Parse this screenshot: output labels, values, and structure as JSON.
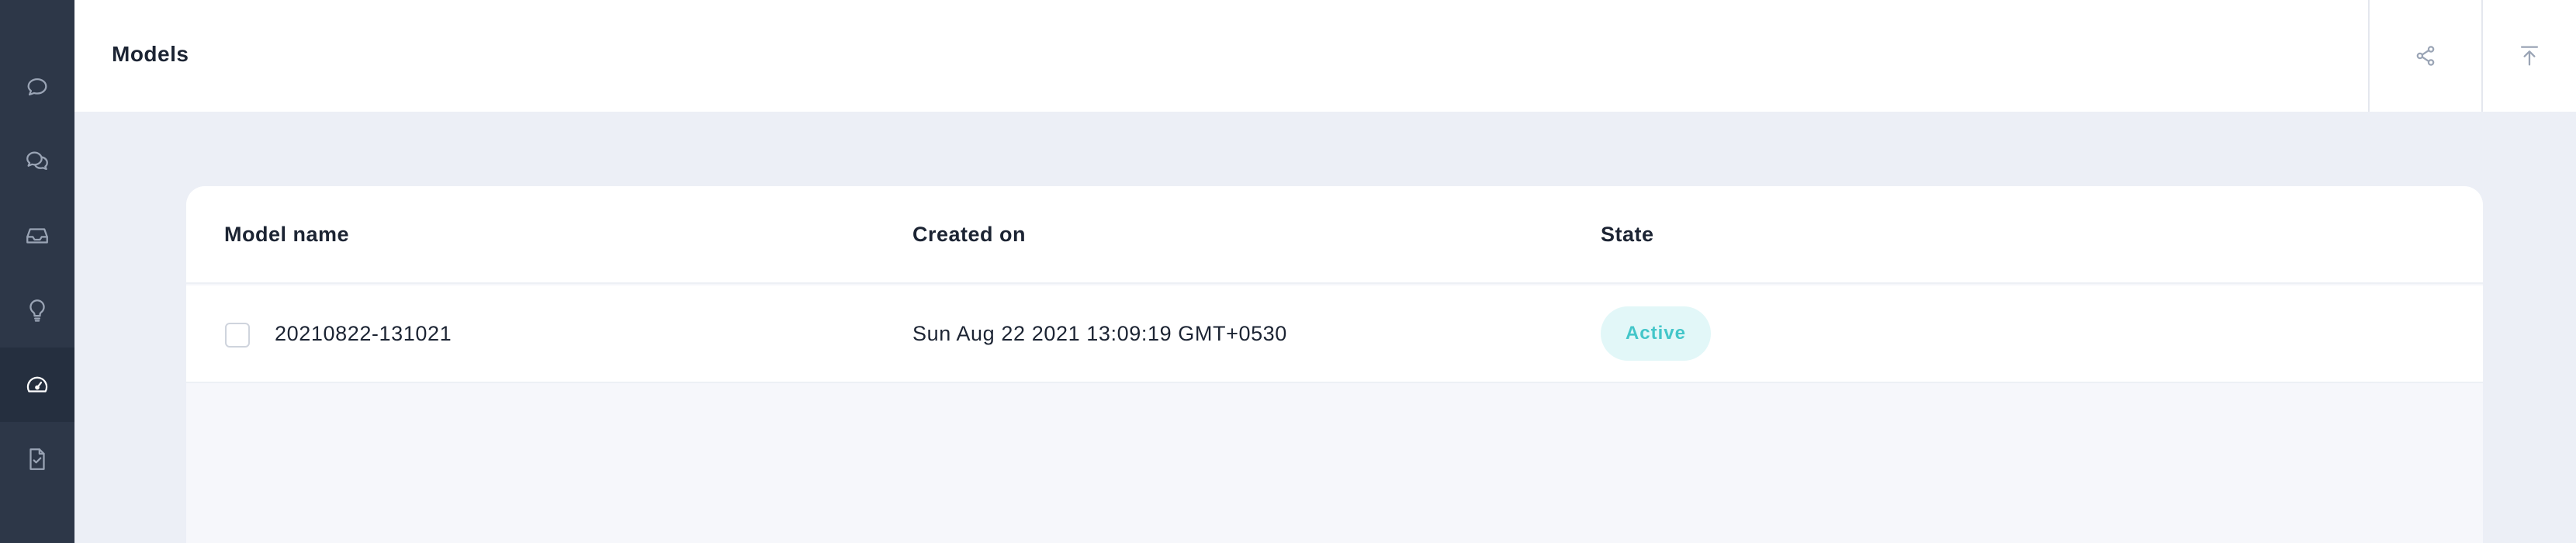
{
  "sidebar": {
    "items": [
      {
        "icon": "chat-bubble-icon",
        "active": false
      },
      {
        "icon": "conversations-icon",
        "active": false
      },
      {
        "icon": "inbox-icon",
        "active": false
      },
      {
        "icon": "lightbulb-icon",
        "active": false
      },
      {
        "icon": "dashboard-gauge-icon",
        "active": true
      },
      {
        "icon": "file-check-icon",
        "active": false
      }
    ]
  },
  "header": {
    "title": "Models",
    "actions": [
      {
        "icon": "share-icon"
      },
      {
        "icon": "upload-icon"
      }
    ]
  },
  "table": {
    "columns": [
      "Model name",
      "Created on",
      "State"
    ],
    "rows": [
      {
        "model_name": "20210822-131021",
        "created_on": "Sun Aug 22 2021 13:09:19 GMT+0530",
        "state": "Active",
        "checked": false
      }
    ]
  },
  "colors": {
    "sidebar_bg": "#2d3748",
    "sidebar_active_bg": "#252f3f",
    "page_bg": "#eceff6",
    "badge_bg": "#e2f7f8",
    "badge_text": "#43c6c9"
  }
}
